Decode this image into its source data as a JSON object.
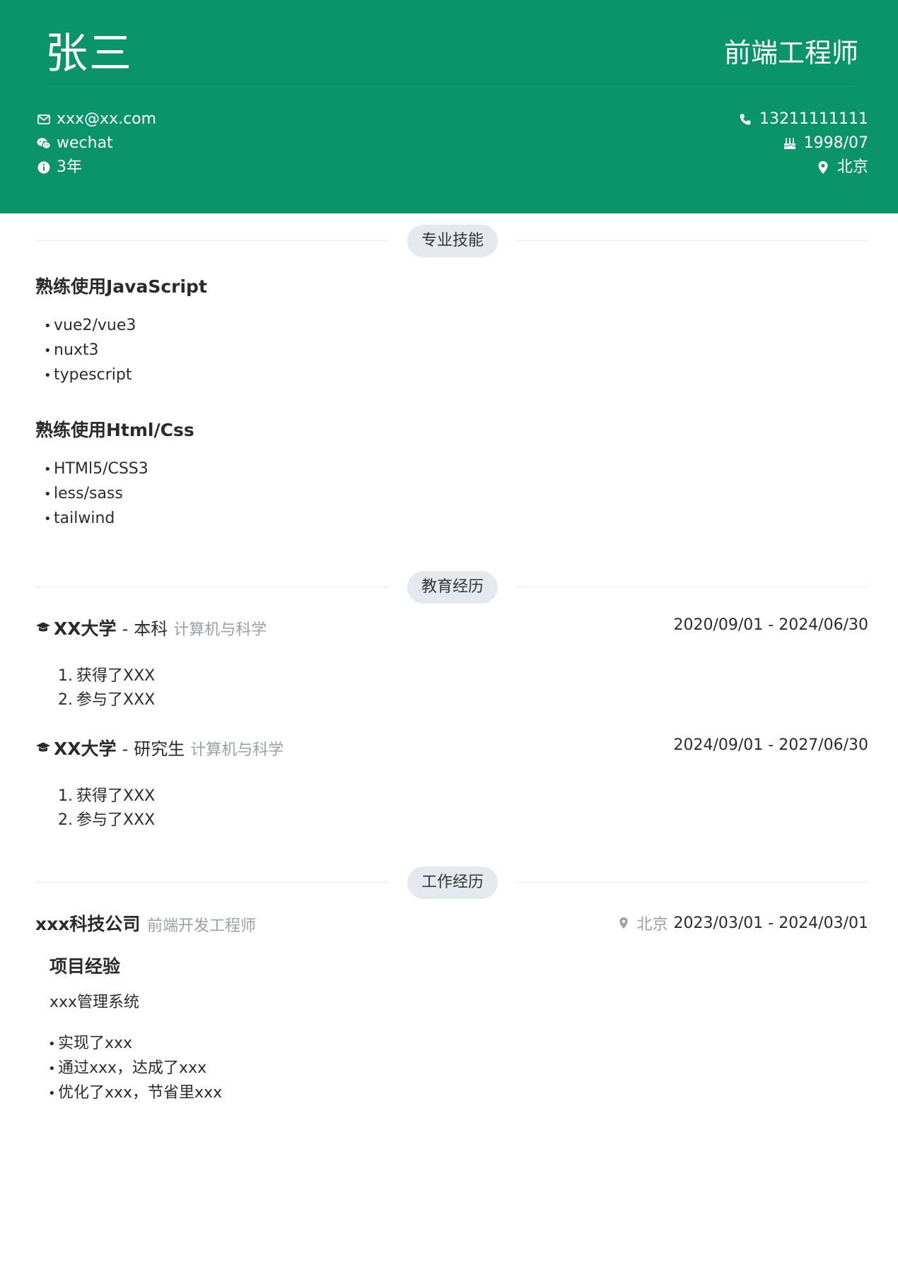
{
  "header": {
    "name": "张三",
    "title": "前端工程师",
    "contacts_left": [
      {
        "icon": "mail-icon",
        "text": "xxx@xx.com"
      },
      {
        "icon": "wechat-icon",
        "text": "wechat"
      },
      {
        "icon": "info-icon",
        "text": "3年"
      }
    ],
    "contacts_right": [
      {
        "icon": "phone-icon",
        "text": "13211111111"
      },
      {
        "icon": "cake-icon",
        "text": "1998/07"
      },
      {
        "icon": "location-icon",
        "text": "北京"
      }
    ]
  },
  "skills": {
    "heading": "专业技能",
    "groups": [
      {
        "title": "熟练使用JavaScript",
        "items": [
          "vue2/vue3",
          "nuxt3",
          "typescript"
        ]
      },
      {
        "title": "熟练使用Html/Css",
        "items": [
          "HTMl5/CSS3",
          "less/sass",
          "tailwind"
        ]
      }
    ]
  },
  "education": {
    "heading": "教育经历",
    "entries": [
      {
        "school": "XX大学",
        "sep": "-",
        "degree": "本科",
        "major": "计算机与科学",
        "date": "2020/09/01 - 2024/06/30",
        "items": [
          "获得了XXX",
          "参与了XXX"
        ]
      },
      {
        "school": "XX大学",
        "sep": "-",
        "degree": "研究生",
        "major": "计算机与科学",
        "date": "2024/09/01 - 2027/06/30",
        "items": [
          "获得了XXX",
          "参与了XXX"
        ]
      }
    ]
  },
  "work": {
    "heading": "工作经历",
    "company": "xxx科技公司",
    "position": "前端开发工程师",
    "city": "北京",
    "date": "2023/03/01 - 2024/03/01",
    "project_heading": "项目经验",
    "project_name": "xxx管理系统",
    "items": [
      "实现了xxx",
      "通过xxx，达成了xxx",
      "优化了xxx，节省里xxx"
    ]
  },
  "colors": {
    "header_bg": "#0b9467",
    "pill_bg": "#e3e9ef",
    "muted_text": "#9aa0a6"
  }
}
